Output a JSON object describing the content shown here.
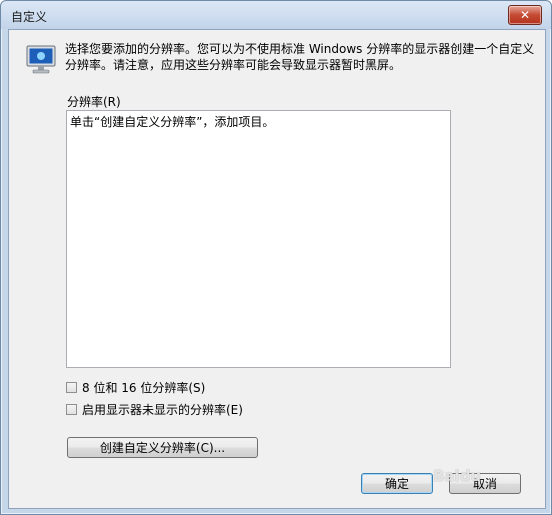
{
  "window": {
    "title": "自定义",
    "close_label": "✕"
  },
  "description": "选择您要添加的分辨率。您可以为不使用标准 Windows 分辨率的显示器创建一个自定义分辨率。请注意，应用这些分辨率可能会导致显示器暂时黑屏。",
  "list": {
    "label": "分辨率(R)",
    "items": [
      "单击“创建自定义分辨率”，添加项目。"
    ]
  },
  "checkboxes": [
    {
      "label": "8 位和 16 位分辨率(S)",
      "checked": false
    },
    {
      "label": "启用显示器未显示的分辨率(E)",
      "checked": false
    }
  ],
  "buttons": {
    "create": "创建自定义分辨率(C)...",
    "ok": "确定",
    "cancel": "取消"
  },
  "watermark": "Baidu"
}
